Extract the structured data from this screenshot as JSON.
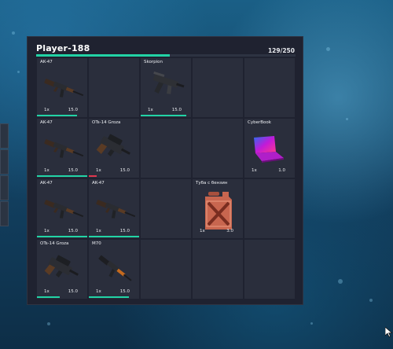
{
  "inventory": {
    "player_name": "Player-188",
    "weight_text": "129/250",
    "weight_fraction": 0.516,
    "slots": [
      {
        "name": "AK-47",
        "qty": "1x",
        "weight": "15.0",
        "icon": "ak47-rifle-icon",
        "durability": 0.8,
        "bar_color": "#22d3a5"
      },
      {
        "name": "",
        "qty": "",
        "weight": "",
        "icon": "",
        "durability": 0
      },
      {
        "name": "Skorpion",
        "qty": "1x",
        "weight": "15.0",
        "icon": "skorpion-smg-icon",
        "durability": 0.9,
        "bar_color": "#22d3a5"
      },
      {
        "name": "",
        "qty": "",
        "weight": "",
        "icon": "",
        "durability": 0
      },
      {
        "name": "",
        "qty": "",
        "weight": "",
        "icon": "",
        "durability": 0
      },
      {
        "name": "AK-47",
        "qty": "1x",
        "weight": "15.0",
        "icon": "ak47-rifle-icon",
        "durability": 1.0,
        "bar_color": "#22d3a5"
      },
      {
        "name": "OTs-14 Groza",
        "qty": "1x",
        "weight": "15.0",
        "icon": "groza-rifle-icon",
        "durability": 0.15,
        "bar_color": "#e0364e"
      },
      {
        "name": "",
        "qty": "",
        "weight": "",
        "icon": "",
        "durability": 0
      },
      {
        "name": "",
        "qty": "",
        "weight": "",
        "icon": "",
        "durability": 0
      },
      {
        "name": "CyberBook",
        "qty": "1x",
        "weight": "1.0",
        "icon": "laptop-icon",
        "durability": 0
      },
      {
        "name": "AK-47",
        "qty": "1x",
        "weight": "15.0",
        "icon": "ak47-rifle-icon",
        "durability": 1.0,
        "bar_color": "#22d3a5"
      },
      {
        "name": "AK-47",
        "qty": "1x",
        "weight": "15.0",
        "icon": "ak47-rifle-icon",
        "durability": 1.0,
        "bar_color": "#22d3a5"
      },
      {
        "name": "",
        "qty": "",
        "weight": "",
        "icon": "",
        "durability": 0
      },
      {
        "name": "Туба с бензин",
        "qty": "1x",
        "weight": "3.0",
        "icon": "jerrycan-icon",
        "durability": 0
      },
      {
        "name": "",
        "qty": "",
        "weight": "",
        "icon": "",
        "durability": 0
      },
      {
        "name": "OTs-14 Groza",
        "qty": "1x",
        "weight": "15.0",
        "icon": "groza-rifle-icon",
        "durability": 0.45,
        "bar_color": "#22d3a5"
      },
      {
        "name": "M70",
        "qty": "1x",
        "weight": "15.0",
        "icon": "m70-rifle-icon",
        "durability": 0.8,
        "bar_color": "#22d3a5"
      },
      {
        "name": "",
        "qty": "",
        "weight": "",
        "icon": "",
        "durability": 0
      },
      {
        "name": "",
        "qty": "",
        "weight": "",
        "icon": "",
        "durability": 0
      },
      {
        "name": "",
        "qty": "",
        "weight": "",
        "icon": "",
        "durability": 0
      }
    ]
  },
  "colors": {
    "accent_green": "#22d3a5",
    "accent_red": "#e0364e",
    "panel": "#1f2230",
    "slot": "#2a2e3c"
  }
}
